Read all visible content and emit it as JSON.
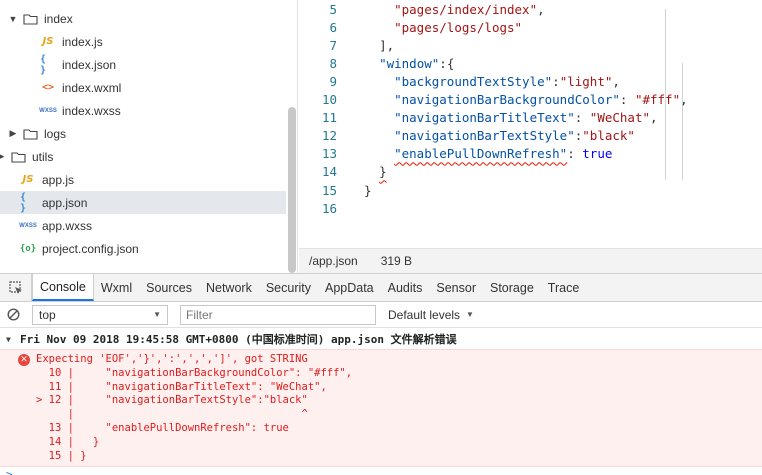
{
  "file_tree": {
    "items": [
      {
        "type": "folder",
        "label": "index",
        "expanded": true
      },
      {
        "type": "js",
        "label": "index.js"
      },
      {
        "type": "json",
        "label": "index.json"
      },
      {
        "type": "wxml",
        "label": "index.wxml"
      },
      {
        "type": "wxss",
        "label": "index.wxss"
      },
      {
        "type": "folder",
        "label": "logs",
        "expanded": false
      },
      {
        "type": "folder",
        "label": "utils",
        "expanded": false
      },
      {
        "type": "js",
        "label": "app.js"
      },
      {
        "type": "json",
        "label": "app.json",
        "selected": true
      },
      {
        "type": "wxss",
        "label": "app.wxss"
      },
      {
        "type": "cfg",
        "label": "project.config.json"
      }
    ],
    "icon_glyphs": {
      "js": "JS",
      "json": "{ }",
      "wxml": "<>",
      "wxss": "WXSS",
      "cfg": "{o}"
    },
    "arrows": {
      "expanded": "▼",
      "collapsed": "▶"
    }
  },
  "editor": {
    "lines": [
      {
        "n": "5",
        "text": "    \"pages/index/index\","
      },
      {
        "n": "6",
        "text": "    \"pages/logs/logs\""
      },
      {
        "n": "7",
        "text": "  ],"
      },
      {
        "n": "8",
        "text": "  \"window\":{"
      },
      {
        "n": "9",
        "text": "    \"backgroundTextStyle\":\"light\","
      },
      {
        "n": "10",
        "text": "    \"navigationBarBackgroundColor\": \"#fff\","
      },
      {
        "n": "11",
        "text": "    \"navigationBarTitleText\": \"WeChat\","
      },
      {
        "n": "12",
        "text": "    \"navigationBarTextStyle\":\"black\""
      },
      {
        "n": "13",
        "text": "    \"enablePullDownRefresh\": true"
      },
      {
        "n": "14",
        "text": "  }"
      },
      {
        "n": "15",
        "text": "}"
      },
      {
        "n": "16",
        "text": ""
      }
    ],
    "status": {
      "file": "/app.json",
      "size": "319 B"
    }
  },
  "devtools": {
    "tabs": [
      "Console",
      "Wxml",
      "Sources",
      "Network",
      "Security",
      "AppData",
      "Audits",
      "Sensor",
      "Storage",
      "Trace"
    ],
    "active_tab": "Console",
    "context": "top",
    "filter_placeholder": "Filter",
    "levels": "Default levels",
    "log_header": "Fri Nov 09 2018 19:45:58 GMT+0800 (中国标准时间)  app.json 文件解析错误",
    "error_lines": [
      "Expecting 'EOF','}',':',',',']', got STRING",
      "  10 |     \"navigationBarBackgroundColor\": \"#fff\",",
      "  11 |     \"navigationBarTitleText\": \"WeChat\",",
      "> 12 |     \"navigationBarTextStyle\":\"black\"",
      "     |                                    ^",
      "  13 |     \"enablePullDownRefresh\": true",
      "  14 |   }",
      "  15 | }"
    ],
    "prompt": ">"
  },
  "colors": {
    "key": "#0451a5",
    "string": "#a31515",
    "keyword": "#0000ff",
    "error_text": "#e01b1b",
    "error_bg": "#fff0f0",
    "active_tab_underline": "#1a73e8"
  }
}
